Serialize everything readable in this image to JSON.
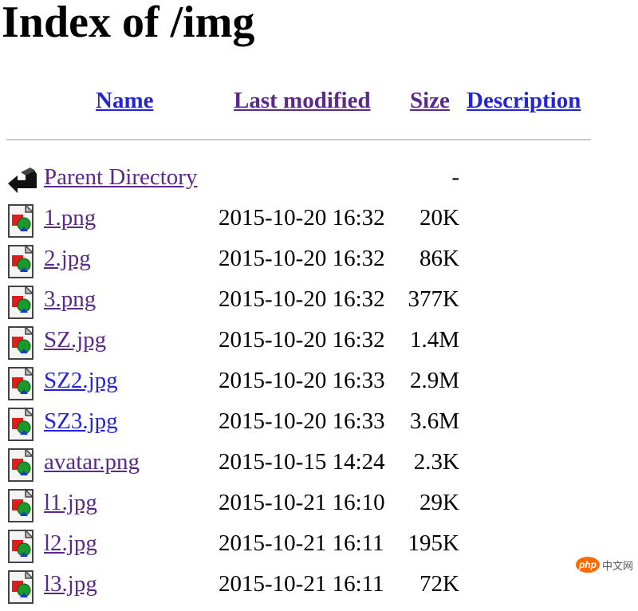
{
  "page": {
    "title": "Index of /img"
  },
  "header": {
    "name": "Name",
    "last_modified": "Last modified",
    "size": "Size",
    "description": "Description"
  },
  "rows": [
    {
      "name": "Parent Directory",
      "date": "",
      "size": "-",
      "icon": "back-arrow-icon",
      "visited": true
    },
    {
      "name": "1.png",
      "date": "2015-10-20 16:32",
      "size": "20K",
      "icon": "image-file-icon",
      "visited": true
    },
    {
      "name": "2.jpg",
      "date": "2015-10-20 16:32",
      "size": "86K",
      "icon": "image-file-icon",
      "visited": true
    },
    {
      "name": "3.png",
      "date": "2015-10-20 16:32",
      "size": "377K",
      "icon": "image-file-icon",
      "visited": true
    },
    {
      "name": "SZ.jpg",
      "date": "2015-10-20 16:32",
      "size": "1.4M",
      "icon": "image-file-icon",
      "visited": true
    },
    {
      "name": "SZ2.jpg",
      "date": "2015-10-20 16:33",
      "size": "2.9M",
      "icon": "image-file-icon",
      "visited": false
    },
    {
      "name": "SZ3.jpg",
      "date": "2015-10-20 16:33",
      "size": "3.6M",
      "icon": "image-file-icon",
      "visited": false
    },
    {
      "name": "avatar.png",
      "date": "2015-10-15 14:24",
      "size": "2.3K",
      "icon": "image-file-icon",
      "visited": true
    },
    {
      "name": "l1.jpg",
      "date": "2015-10-21 16:10",
      "size": "29K",
      "icon": "image-file-icon",
      "visited": true
    },
    {
      "name": "l2.jpg",
      "date": "2015-10-21 16:11",
      "size": "195K",
      "icon": "image-file-icon",
      "visited": true
    },
    {
      "name": "l3.jpg",
      "date": "2015-10-21 16:11",
      "size": "72K",
      "icon": "image-file-icon",
      "visited": true
    }
  ],
  "watermark": {
    "badge": "php",
    "text": "中文网"
  },
  "colors": {
    "link_unvisited": "#2424d8",
    "link_visited": "#5a2a8a",
    "rule": "#c8c8c8"
  }
}
